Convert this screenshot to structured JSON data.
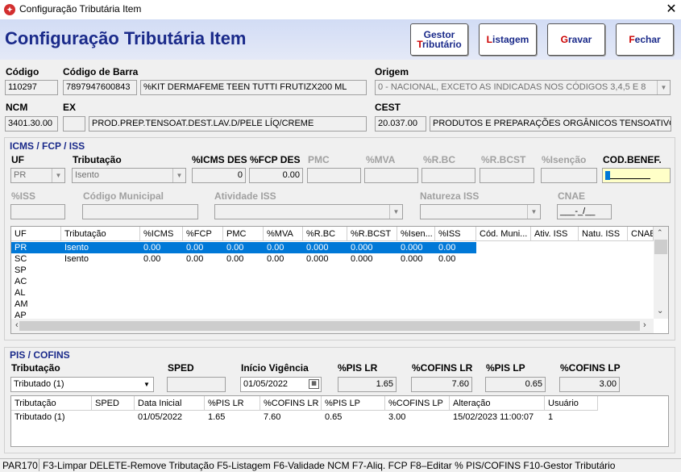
{
  "window": {
    "title": "Configuração Tributária Item"
  },
  "page_title": "Configuração Tributária Item",
  "toolbar": {
    "gestor_line1": "Gestor",
    "gestor_hot": "T",
    "gestor_rest": "ributário",
    "listagem_hot": "L",
    "listagem_rest": "istagem",
    "gravar_hot": "G",
    "gravar_rest": "ravar",
    "fechar_hot": "F",
    "fechar_rest": "echar"
  },
  "item": {
    "codigo_label": "Código",
    "codigo": "110297",
    "codigo_barra_label": "Código de Barra",
    "codigo_barra": "7897947600843",
    "descricao": "%KIT DERMAFEME TEEN  TUTTI FRUTIZX200 ML",
    "origem_label": "Origem",
    "origem": "0 - NACIONAL, EXCETO AS INDICADAS NOS CÓDIGOS 3,4,5 E 8",
    "ncm_label": "NCM",
    "ncm": "3401.30.00",
    "ex_label": "EX",
    "ex": "",
    "ncm_descricao": "PROD.PREP.TENSOAT.DEST.LAV.D/PELE LÍQ/CREME",
    "cest_label": "CEST",
    "cest": "20.037.00",
    "cest_descricao": "PRODUTOS E PREPARAÇÕES ORGÂNICOS TENSOATIVO"
  },
  "icms": {
    "group_title": "ICMS / FCP / ISS",
    "uf_label": "UF",
    "uf": "PR",
    "tributacao_label": "Tributação",
    "tributacao": "Isento",
    "icms_des_label": "%ICMS DES",
    "icms_des": "0",
    "fcp_des_label": "%FCP DES",
    "fcp_des": "0.00",
    "pmc_label": "PMC",
    "mva_label": "%MVA",
    "rbc_label": "%R.BC",
    "rbcst_label": "%R.BCST",
    "isencao_label": "%Isenção",
    "cod_benef_label": "COD.BENEF.",
    "iss_label": "%ISS",
    "codigo_municipal_label": "Código Municipal",
    "atividade_iss_label": "Atividade ISS",
    "natureza_iss_label": "Natureza ISS",
    "cnae_label": "CNAE",
    "cnae_mask": "___-_/__",
    "grid": {
      "columns": [
        "UF",
        "Tributação",
        "%ICMS",
        "%FCP",
        "PMC",
        "%MVA",
        "%R.BC",
        "%R.BCST",
        "%Isen...",
        "%ISS",
        "Cód. Muni...",
        "Ativ. ISS",
        "Natu. ISS",
        "CNAE"
      ],
      "rows": [
        [
          "PR",
          "Isento",
          "0.00",
          "0.00",
          "0.00",
          "0.00",
          "0.000",
          "0.000",
          "0.000",
          "0.00",
          "",
          "",
          "",
          ""
        ],
        [
          "SC",
          "Isento",
          "0.00",
          "0.00",
          "0.00",
          "0.00",
          "0.000",
          "0.000",
          "0.000",
          "0.00",
          "",
          "",
          "",
          ""
        ],
        [
          "SP",
          "",
          "",
          "",
          "",
          "",
          "",
          "",
          "",
          "",
          "",
          "",
          "",
          ""
        ],
        [
          "AC",
          "",
          "",
          "",
          "",
          "",
          "",
          "",
          "",
          "",
          "",
          "",
          "",
          ""
        ],
        [
          "AL",
          "",
          "",
          "",
          "",
          "",
          "",
          "",
          "",
          "",
          "",
          "",
          "",
          ""
        ],
        [
          "AM",
          "",
          "",
          "",
          "",
          "",
          "",
          "",
          "",
          "",
          "",
          "",
          "",
          ""
        ],
        [
          "AP",
          "",
          "",
          "",
          "",
          "",
          "",
          "",
          "",
          "",
          "",
          "",
          "",
          ""
        ]
      ]
    }
  },
  "pis": {
    "group_title": "PIS / COFINS",
    "tributacao_label": "Tributação",
    "tributacao": "Tributado (1)",
    "sped_label": "SPED",
    "sped": "",
    "inicio_label": "Início Vigência",
    "inicio": "01/05/2022",
    "pis_lr_label": "%PIS LR",
    "pis_lr": "1.65",
    "cofins_lr_label": "%COFINS LR",
    "cofins_lr": "7.60",
    "pis_lp_label": "%PIS LP",
    "pis_lp": "0.65",
    "cofins_lp_label": "%COFINS LP",
    "cofins_lp": "3.00",
    "grid": {
      "columns": [
        "Tributação",
        "SPED",
        "Data Inicial",
        "%PIS LR",
        "%COFINS LR",
        "%PIS LP",
        "%COFINS LP",
        "Alteração",
        "Usuário"
      ],
      "rows": [
        [
          "Tributado (1)",
          "",
          "01/05/2022",
          "1.65",
          "7.60",
          "0.65",
          "3.00",
          "15/02/2023 11:00:07",
          "1"
        ]
      ]
    }
  },
  "status": {
    "code": "PAR170",
    "hints": "F3-Limpar  DELETE-Remove Tributação  F5-Listagem  F6-Validade NCM  F7-Aliq. FCP  F8–Editar % PIS/COFINS  F10-Gestor Tributário"
  }
}
